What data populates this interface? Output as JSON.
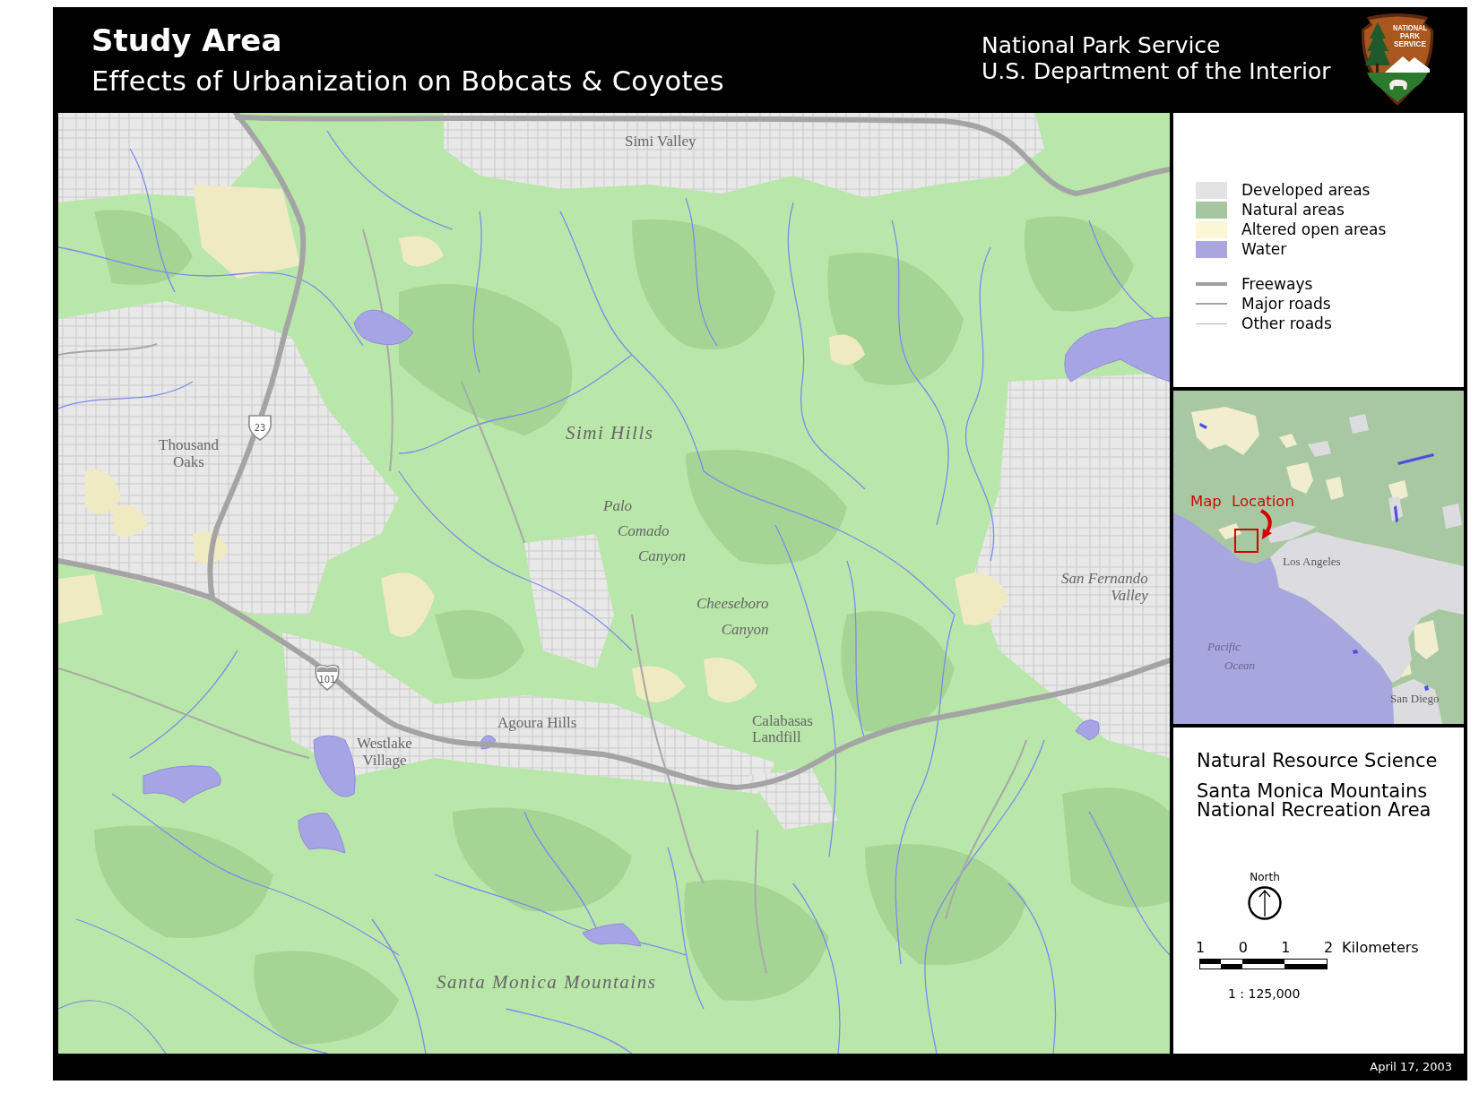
{
  "header": {
    "title": "Study Area",
    "subtitle": "Effects of Urbanization on Bobcats & Coyotes",
    "agency": [
      "National Park Service",
      "U.S. Department of the Interior"
    ],
    "logo_text": [
      "NATIONAL",
      "PARK",
      "SERVICE"
    ]
  },
  "map": {
    "place_labels": [
      {
        "kind": "city",
        "lines": [
          "Simi Valley"
        ]
      },
      {
        "kind": "city",
        "lines": [
          "Thousand",
          "Oaks"
        ]
      },
      {
        "kind": "region",
        "lines": [
          "Simi Hills"
        ]
      },
      {
        "kind": "feature",
        "lines": [
          "Palo",
          "Comado",
          "Canyon"
        ]
      },
      {
        "kind": "feature",
        "lines": [
          "Cheeseboro",
          "Canyon"
        ]
      },
      {
        "kind": "feature",
        "lines": [
          "San Fernando",
          "Valley"
        ]
      },
      {
        "kind": "city",
        "lines": [
          "Agoura Hills"
        ]
      },
      {
        "kind": "city",
        "lines": [
          "Westlake",
          "Village"
        ]
      },
      {
        "kind": "city",
        "lines": [
          "Calabasas",
          "Landfill"
        ]
      },
      {
        "kind": "region",
        "lines": [
          "Santa Monica Mountains"
        ]
      }
    ],
    "route_shields": [
      {
        "kind": "us",
        "number": "23"
      },
      {
        "kind": "interstate",
        "number": "101"
      }
    ]
  },
  "legend": {
    "items": [
      {
        "kind": "fill",
        "label": "Developed areas",
        "color": "#e3e3e3"
      },
      {
        "kind": "fill",
        "label": "Natural areas",
        "color": "#a6c6a0"
      },
      {
        "kind": "fill",
        "label": "Altered open areas",
        "color": "#fbf6d6"
      },
      {
        "kind": "fill",
        "label": "Water",
        "color": "#a9a6df"
      },
      {
        "kind": "heavy",
        "label": "Freeways"
      },
      {
        "kind": "medium",
        "label": "Major roads"
      },
      {
        "kind": "light",
        "label": "Other roads"
      }
    ]
  },
  "inset_map": {
    "callout": "Map Location",
    "labels": [
      {
        "kind": "city",
        "lines": [
          "Los Angeles"
        ]
      },
      {
        "kind": "water",
        "lines": [
          "Pacific",
          "Ocean"
        ]
      },
      {
        "kind": "city",
        "lines": [
          "San Diego"
        ]
      }
    ]
  },
  "credits": {
    "program": "Natural Resource Science",
    "unit": [
      "Santa Monica Mountains",
      "National Recreation Area"
    ]
  },
  "north_arrow": {
    "label": "North"
  },
  "scale_bar": {
    "ticks": [
      "1",
      "0",
      "1",
      "2"
    ],
    "unit": "Kilometers",
    "ratio": "1 : 125,000"
  },
  "footer": {
    "date": "April 17, 2003"
  }
}
